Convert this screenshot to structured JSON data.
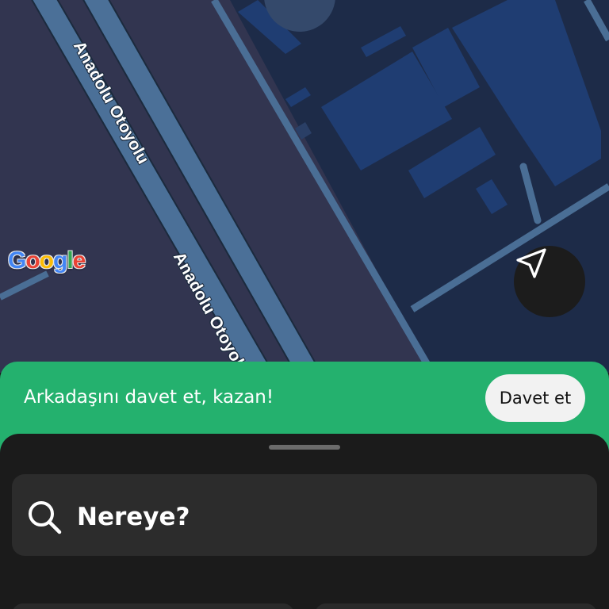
{
  "map": {
    "road_label_1": "Anadolu Otoyolu",
    "road_label_2": "Anadolu Otoyolu",
    "provider_logo": "Google",
    "locate_icon": "navigation-arrow-icon"
  },
  "invite_banner": {
    "text": "Arkadaşını davet et, kazan!",
    "button_label": "Davet et",
    "color": "#24b16e"
  },
  "search": {
    "icon": "search-icon",
    "placeholder": "Nereye?"
  },
  "colors": {
    "map_background": "#323550",
    "map_blocks": "#1d2b48",
    "buildings": "#1f3d72",
    "roads": "#4a6e95",
    "sheet": "#1b1b1b"
  }
}
